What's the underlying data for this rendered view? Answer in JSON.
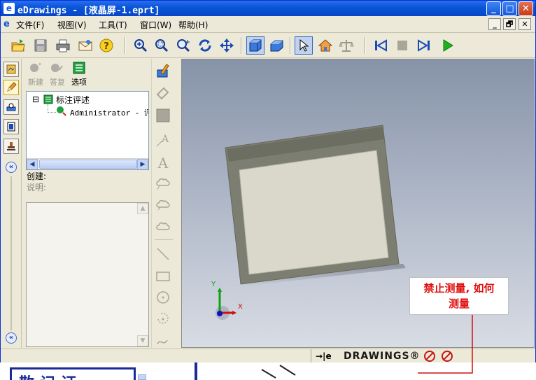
{
  "window": {
    "title": "eDrawings - [液晶屏-1.eprt]",
    "app_icon": "e",
    "controls": {
      "minimize": "_",
      "maximize": "□",
      "close": "✕"
    }
  },
  "menu": {
    "doc_icon": "e",
    "items": [
      {
        "label": "文件(F)"
      },
      {
        "label": "视图(V)"
      },
      {
        "label": "工具(T)"
      },
      {
        "label": "窗口(W)"
      },
      {
        "label": "帮助(H)"
      }
    ],
    "mdi": {
      "minimize": "_",
      "restore": "🗗",
      "close": "✕"
    }
  },
  "toolbar": {
    "icons": [
      "open-icon",
      "save-icon",
      "print-icon",
      "mail-icon",
      "help-icon",
      "zoom-fit-icon",
      "zoom-area-icon",
      "zoom-icon",
      "rotate-icon",
      "pan-icon",
      "shaded-cube-icon",
      "perspective-icon",
      "select-arrow-icon",
      "home-icon",
      "measure-scale-icon",
      "first-frame-icon",
      "stop-icon",
      "next-frame-icon",
      "play-icon"
    ]
  },
  "left_rail": {
    "collapse_top": "«",
    "collapse_bottom": "«"
  },
  "panel": {
    "tools": [
      {
        "label": "新建",
        "enabled": false
      },
      {
        "label": "答复",
        "enabled": false
      },
      {
        "label": "选项",
        "enabled": true
      }
    ],
    "tree": {
      "root_toggle": "⊟",
      "root_label": "标注评述",
      "child_label": "Administrator - 评"
    },
    "created_label": "创建:",
    "description_label": "说明:"
  },
  "statusbar": {
    "brand": "DRAWINGS®",
    "brand_prefix": "→|e"
  },
  "annotation": {
    "line1": "禁止测量, 如何",
    "line2": "测量"
  },
  "background": {
    "doc_text": "散记证",
    "color": "#1a2a9a"
  },
  "axes": {
    "x": "X",
    "y": "Y"
  },
  "colors": {
    "accent": "#0a56d8",
    "annotation": "#e01010",
    "viewport_top": "#8693a8",
    "viewport_bottom": "#d8dce4"
  }
}
